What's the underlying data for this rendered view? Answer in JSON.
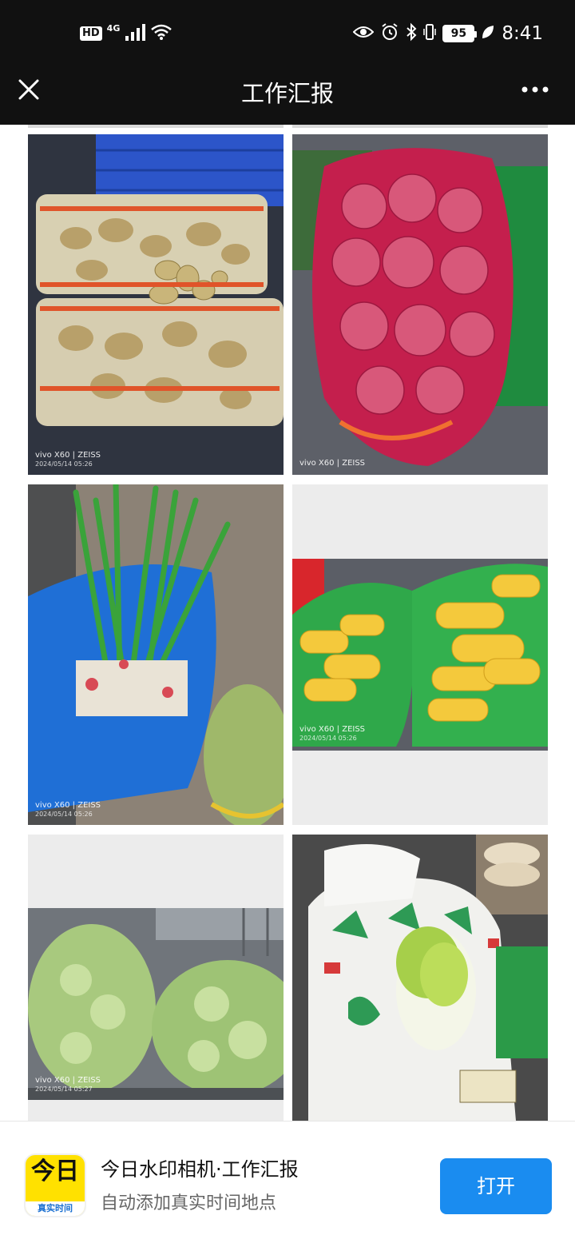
{
  "status_bar": {
    "hd": "HD",
    "network": "4G",
    "battery": "95",
    "time": "8:41"
  },
  "title_bar": {
    "title": "工作汇报"
  },
  "photos": [
    {
      "brand": "vivo X60 | ZEISS",
      "stamp": "2024/05/14 05:26"
    },
    {
      "brand": "vivo X60 | ZEISS",
      "stamp": ""
    },
    {
      "brand": "vivo X60 | ZEISS",
      "stamp": "2024/05/14 05:26"
    },
    {
      "brand": "vivo X60 | ZEISS",
      "stamp": "2024/05/14 05:26"
    },
    {
      "brand": "vivo X60 | ZEISS",
      "stamp": "2024/05/14 05:27"
    },
    {
      "brand": "",
      "stamp": ""
    }
  ],
  "banner": {
    "icon_big": "今日",
    "icon_small": "真实时间",
    "title": "今日水印相机·工作汇报",
    "subtitle": "自动添加真实时间地点",
    "open_label": "打开"
  },
  "colors": {
    "bar_bg": "#111111",
    "accent_button": "#1a8cf0",
    "app_icon_yellow": "#ffe100"
  }
}
